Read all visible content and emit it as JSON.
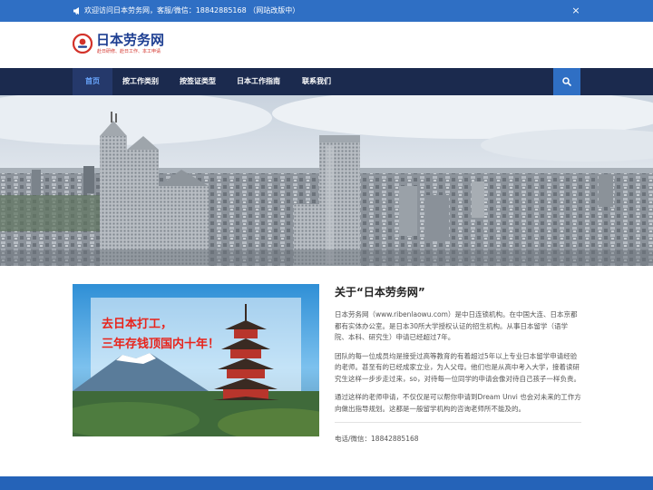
{
  "announcement": {
    "text": "欢迎访问日本劳务网，客服/微信：18842885168 （网站改版中）",
    "close_glyph": "×"
  },
  "logo": {
    "title": "日本劳务网",
    "subtitle": "赴日研修、赴日工作、本工申请"
  },
  "nav": {
    "items": [
      {
        "label": "首页",
        "active": true
      },
      {
        "label": "按工作类别"
      },
      {
        "label": "按签证类型"
      },
      {
        "label": "日本工作指南"
      },
      {
        "label": "联系我们"
      }
    ],
    "search_icon": "search-icon"
  },
  "promo": {
    "line1": "去日本打工，",
    "line2": "三年存钱顶国内十年！"
  },
  "about": {
    "title": "关于“日本劳务网”",
    "p1": "日本劳务网（www.ribenlaowu.com）是中日连锁机构。在中国大连、日本京都都有实体办公室。是日本30所大学授权认证的招生机构。从事日本留学（语学院、本科、研究生）申请已经超过7年。",
    "p2": "团队的每一位成员均是接受过高等教育的有着超过5年以上专业日本留学申请经验的老师。甚至有的已经成家立业，为人父母。他们也是从高中考入大学，接着读研究生这样一步步走过来，so，对待每一位同学的申请会像对待自己孩子一样负责。",
    "p3": "通过这样的老师申请，不仅仅是可以帮你申请到Dream Unvi 也会对未来的工作方向做出指导规划。这都是一般留学机构的咨询老师所不能及的。",
    "contact": "电话/微信：18842885168"
  },
  "colors": {
    "topbar": "#2f6fc4",
    "nav": "#1b2a4e",
    "nav_active_text": "#6aa7ff",
    "promo_text": "#e8231b",
    "footer": "#2563b8"
  }
}
